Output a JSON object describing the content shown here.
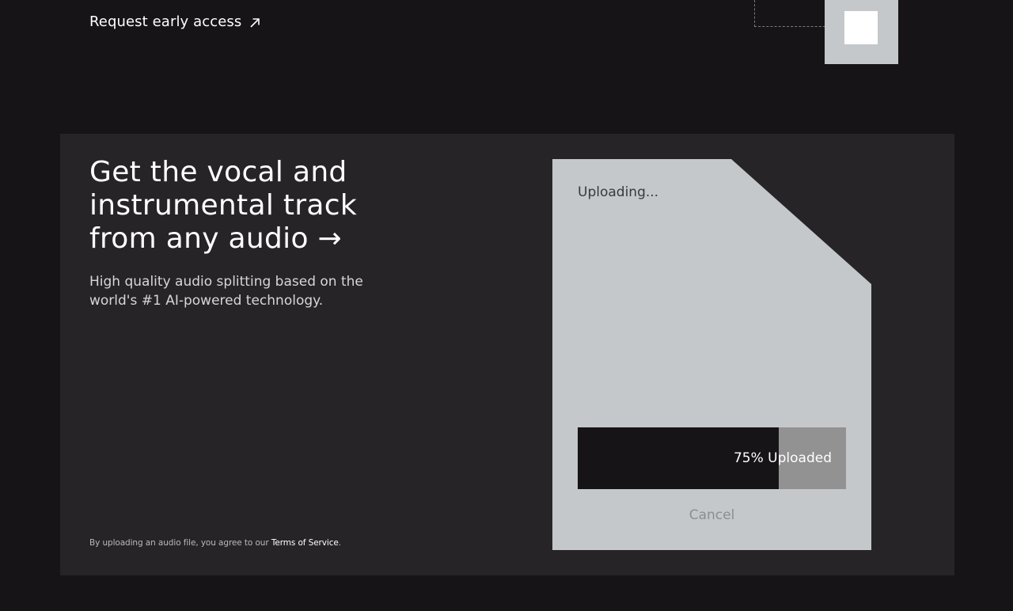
{
  "header": {
    "request_access_label": "Request early access",
    "request_access_icon": "arrow-up-right-icon"
  },
  "hero": {
    "headline": "Get the vocal and instrumental track from any audio →",
    "subtitle": "High quality audio splitting based on the world's #1 AI-powered technology."
  },
  "legal": {
    "prefix": "By uploading an audio file, you agree to our ",
    "terms_link": "Terms of Service",
    "suffix": "."
  },
  "upload_card": {
    "status": "Uploading...",
    "progress_percent": 75,
    "progress_label": "75% Uploaded",
    "cancel_label": "Cancel"
  },
  "colors": {
    "background": "#161417",
    "panel": "#262427",
    "card": "#c4c8cb",
    "progress_fill": "#161417",
    "progress_track": "#929292"
  }
}
